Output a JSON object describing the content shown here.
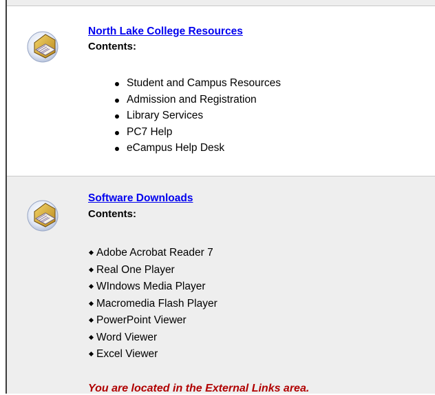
{
  "sections": [
    {
      "title": "North Lake College Resources",
      "contents_label": "Contents:",
      "items": [
        "Student and Campus Resources",
        "Admission and Registration",
        "Library Services",
        "PC7 Help",
        "eCampus Help Desk"
      ]
    },
    {
      "title": "Software Downloads",
      "contents_label": "Contents:",
      "items": [
        "Adobe Acrobat Reader 7",
        "Real One Player",
        "WIndows Media Player",
        "Macromedia Flash Player",
        "PowerPoint Viewer",
        "Word Viewer",
        "Excel Viewer"
      ]
    }
  ],
  "location_message": "You are located in the External Links area.",
  "colors": {
    "link": "#0000ee",
    "location_text": "#b00000",
    "section_gray": "#eeeeee"
  },
  "icons": [
    "folder-icon",
    "folder-icon"
  ]
}
